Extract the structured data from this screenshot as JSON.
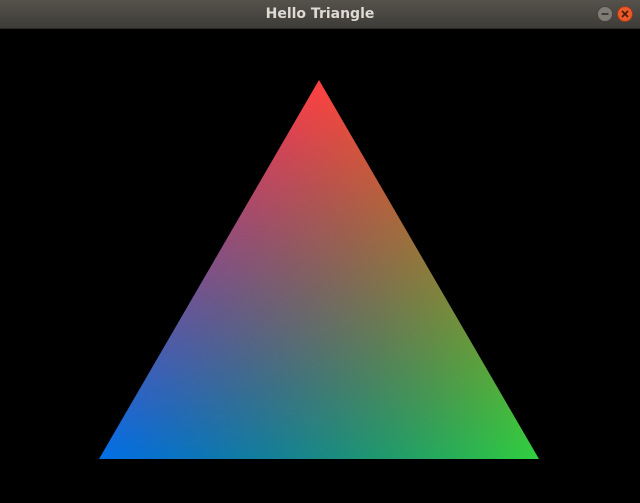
{
  "window": {
    "title": "Hello Triangle",
    "buttons": {
      "minimize": "minimize-icon",
      "close": "close-icon"
    },
    "colors": {
      "titlebar": "#4a4843",
      "title_text": "#dfdbd2",
      "close_button": "#ea5a2a",
      "minimize_button": "#7f7c76",
      "background": "#000000"
    }
  },
  "scene": {
    "clear_color": "#000000",
    "triangle": {
      "vertex_colors": {
        "top": "#ff4040",
        "bottom_left": "#0070e8",
        "bottom_right": "#30d040"
      }
    }
  }
}
